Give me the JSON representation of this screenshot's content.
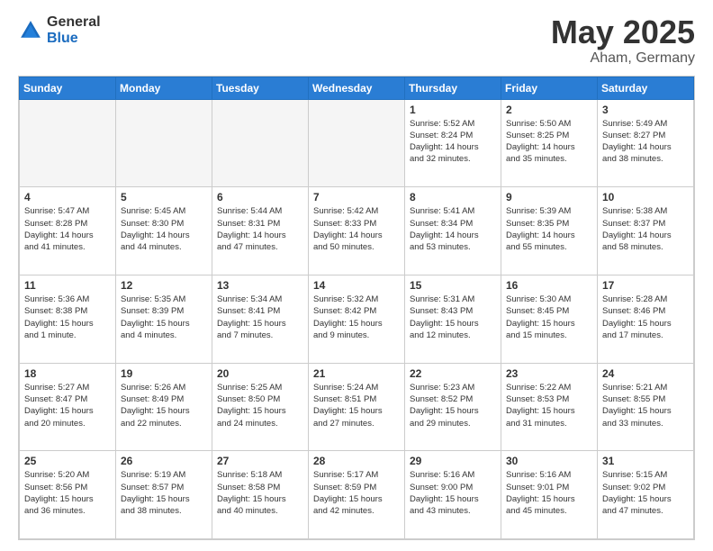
{
  "header": {
    "logo_general": "General",
    "logo_blue": "Blue",
    "title": "May 2025",
    "location": "Aham, Germany"
  },
  "weekdays": [
    "Sunday",
    "Monday",
    "Tuesday",
    "Wednesday",
    "Thursday",
    "Friday",
    "Saturday"
  ],
  "weeks": [
    [
      {
        "day": "",
        "info": ""
      },
      {
        "day": "",
        "info": ""
      },
      {
        "day": "",
        "info": ""
      },
      {
        "day": "",
        "info": ""
      },
      {
        "day": "1",
        "info": "Sunrise: 5:52 AM\nSunset: 8:24 PM\nDaylight: 14 hours\nand 32 minutes."
      },
      {
        "day": "2",
        "info": "Sunrise: 5:50 AM\nSunset: 8:25 PM\nDaylight: 14 hours\nand 35 minutes."
      },
      {
        "day": "3",
        "info": "Sunrise: 5:49 AM\nSunset: 8:27 PM\nDaylight: 14 hours\nand 38 minutes."
      }
    ],
    [
      {
        "day": "4",
        "info": "Sunrise: 5:47 AM\nSunset: 8:28 PM\nDaylight: 14 hours\nand 41 minutes."
      },
      {
        "day": "5",
        "info": "Sunrise: 5:45 AM\nSunset: 8:30 PM\nDaylight: 14 hours\nand 44 minutes."
      },
      {
        "day": "6",
        "info": "Sunrise: 5:44 AM\nSunset: 8:31 PM\nDaylight: 14 hours\nand 47 minutes."
      },
      {
        "day": "7",
        "info": "Sunrise: 5:42 AM\nSunset: 8:33 PM\nDaylight: 14 hours\nand 50 minutes."
      },
      {
        "day": "8",
        "info": "Sunrise: 5:41 AM\nSunset: 8:34 PM\nDaylight: 14 hours\nand 53 minutes."
      },
      {
        "day": "9",
        "info": "Sunrise: 5:39 AM\nSunset: 8:35 PM\nDaylight: 14 hours\nand 55 minutes."
      },
      {
        "day": "10",
        "info": "Sunrise: 5:38 AM\nSunset: 8:37 PM\nDaylight: 14 hours\nand 58 minutes."
      }
    ],
    [
      {
        "day": "11",
        "info": "Sunrise: 5:36 AM\nSunset: 8:38 PM\nDaylight: 15 hours\nand 1 minute."
      },
      {
        "day": "12",
        "info": "Sunrise: 5:35 AM\nSunset: 8:39 PM\nDaylight: 15 hours\nand 4 minutes."
      },
      {
        "day": "13",
        "info": "Sunrise: 5:34 AM\nSunset: 8:41 PM\nDaylight: 15 hours\nand 7 minutes."
      },
      {
        "day": "14",
        "info": "Sunrise: 5:32 AM\nSunset: 8:42 PM\nDaylight: 15 hours\nand 9 minutes."
      },
      {
        "day": "15",
        "info": "Sunrise: 5:31 AM\nSunset: 8:43 PM\nDaylight: 15 hours\nand 12 minutes."
      },
      {
        "day": "16",
        "info": "Sunrise: 5:30 AM\nSunset: 8:45 PM\nDaylight: 15 hours\nand 15 minutes."
      },
      {
        "day": "17",
        "info": "Sunrise: 5:28 AM\nSunset: 8:46 PM\nDaylight: 15 hours\nand 17 minutes."
      }
    ],
    [
      {
        "day": "18",
        "info": "Sunrise: 5:27 AM\nSunset: 8:47 PM\nDaylight: 15 hours\nand 20 minutes."
      },
      {
        "day": "19",
        "info": "Sunrise: 5:26 AM\nSunset: 8:49 PM\nDaylight: 15 hours\nand 22 minutes."
      },
      {
        "day": "20",
        "info": "Sunrise: 5:25 AM\nSunset: 8:50 PM\nDaylight: 15 hours\nand 24 minutes."
      },
      {
        "day": "21",
        "info": "Sunrise: 5:24 AM\nSunset: 8:51 PM\nDaylight: 15 hours\nand 27 minutes."
      },
      {
        "day": "22",
        "info": "Sunrise: 5:23 AM\nSunset: 8:52 PM\nDaylight: 15 hours\nand 29 minutes."
      },
      {
        "day": "23",
        "info": "Sunrise: 5:22 AM\nSunset: 8:53 PM\nDaylight: 15 hours\nand 31 minutes."
      },
      {
        "day": "24",
        "info": "Sunrise: 5:21 AM\nSunset: 8:55 PM\nDaylight: 15 hours\nand 33 minutes."
      }
    ],
    [
      {
        "day": "25",
        "info": "Sunrise: 5:20 AM\nSunset: 8:56 PM\nDaylight: 15 hours\nand 36 minutes."
      },
      {
        "day": "26",
        "info": "Sunrise: 5:19 AM\nSunset: 8:57 PM\nDaylight: 15 hours\nand 38 minutes."
      },
      {
        "day": "27",
        "info": "Sunrise: 5:18 AM\nSunset: 8:58 PM\nDaylight: 15 hours\nand 40 minutes."
      },
      {
        "day": "28",
        "info": "Sunrise: 5:17 AM\nSunset: 8:59 PM\nDaylight: 15 hours\nand 42 minutes."
      },
      {
        "day": "29",
        "info": "Sunrise: 5:16 AM\nSunset: 9:00 PM\nDaylight: 15 hours\nand 43 minutes."
      },
      {
        "day": "30",
        "info": "Sunrise: 5:16 AM\nSunset: 9:01 PM\nDaylight: 15 hours\nand 45 minutes."
      },
      {
        "day": "31",
        "info": "Sunrise: 5:15 AM\nSunset: 9:02 PM\nDaylight: 15 hours\nand 47 minutes."
      }
    ]
  ]
}
